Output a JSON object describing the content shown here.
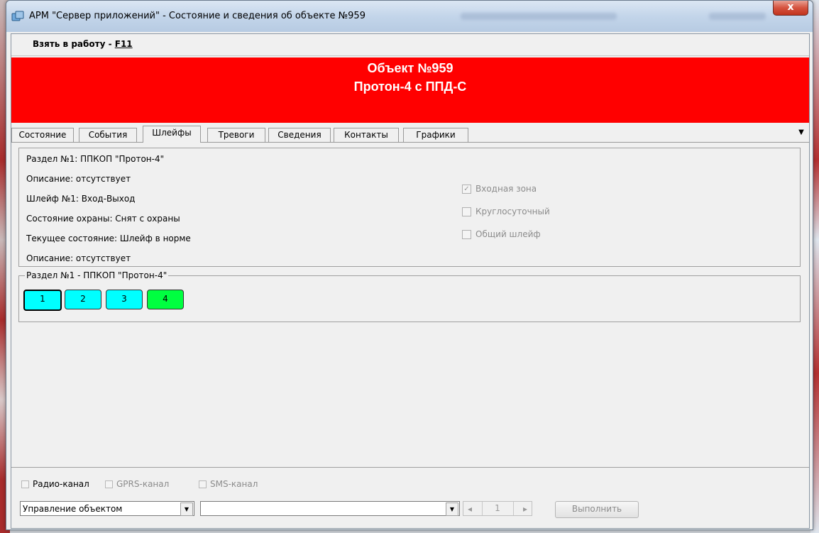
{
  "window": {
    "title": "АРМ \"Сервер приложений\" - Состояние и сведения об объекте №959",
    "close_glyph": "x"
  },
  "menubar": {
    "take_label": "Взять в работу - ",
    "take_key": "F11"
  },
  "banner": {
    "color": "#ff0000",
    "object_line": "Объект №959",
    "device_line": "Протон-4 с ППД-С"
  },
  "tabs": [
    {
      "label": "Состояние"
    },
    {
      "label": "События"
    },
    {
      "label": "Шлейфы"
    },
    {
      "label": "Тревоги"
    },
    {
      "label": "Сведения"
    },
    {
      "label": "Контакты"
    },
    {
      "label": "Графики"
    }
  ],
  "active_tab": "Шлейфы",
  "loop_info": {
    "section": "Раздел №1:  ППКОП \"Протон-4\"",
    "description1": "Описание: отсутствует",
    "loop": "Шлейф №1:  Вход-Выход",
    "guard_state": "Состояние охраны:  Снят с охраны",
    "current_state": "Текущее состояние:  Шлейф в норме",
    "description2": "Описание: отсутствует"
  },
  "loop_flags": [
    {
      "label": "Входная зона",
      "checked": true
    },
    {
      "label": "Круглосуточный",
      "checked": false
    },
    {
      "label": "Общий шлейф",
      "checked": false
    }
  ],
  "zones_group": {
    "title": "Раздел №1 - ППКОП \"Протон-4\"",
    "zones": [
      {
        "label": "1",
        "color": "#00ffff",
        "selected": true
      },
      {
        "label": "2",
        "color": "#00ffff",
        "selected": false
      },
      {
        "label": "3",
        "color": "#00ffff",
        "selected": false
      },
      {
        "label": "4",
        "color": "#00ff40",
        "selected": false
      }
    ]
  },
  "channels": [
    {
      "label": "Радио-канал",
      "enabled": true
    },
    {
      "label": "GPRS-канал",
      "enabled": false
    },
    {
      "label": "SMS-канал",
      "enabled": false
    }
  ],
  "controls": {
    "mode_select": "Управление объектом",
    "command_select": "",
    "page": "1",
    "execute_label": "Выполнить"
  }
}
